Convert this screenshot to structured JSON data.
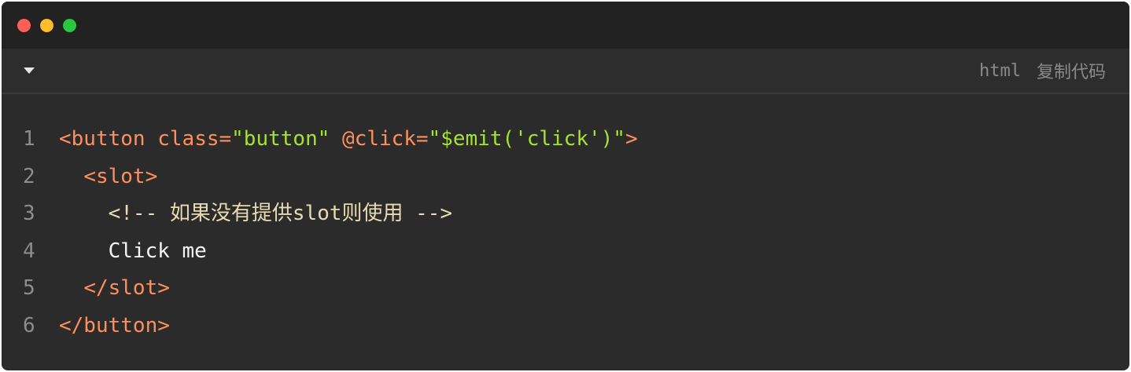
{
  "window": {
    "traffic_lights": [
      {
        "name": "close",
        "color": "#ff5f57"
      },
      {
        "name": "minimize",
        "color": "#febc2e"
      },
      {
        "name": "zoom",
        "color": "#28c840"
      }
    ]
  },
  "toolbar": {
    "collapse_icon": "caret-down-icon",
    "language": "html",
    "copy_label": "复制代码"
  },
  "code": {
    "lines": [
      {
        "number": "1",
        "tokens": [
          {
            "type": "tag",
            "text": "<button "
          },
          {
            "type": "attr",
            "text": "class="
          },
          {
            "type": "str",
            "text": "\"button\" "
          },
          {
            "type": "attr",
            "text": "@click="
          },
          {
            "type": "str",
            "text": "\"$emit('click')\""
          },
          {
            "type": "tag",
            "text": ">"
          }
        ]
      },
      {
        "number": "2",
        "tokens": [
          {
            "type": "text",
            "text": "  "
          },
          {
            "type": "tag",
            "text": "<slot>"
          }
        ]
      },
      {
        "number": "3",
        "tokens": [
          {
            "type": "text",
            "text": "    "
          },
          {
            "type": "comment",
            "text": "<!-- 如果没有提供slot则使用 -->"
          }
        ]
      },
      {
        "number": "4",
        "tokens": [
          {
            "type": "text",
            "text": "    Click me"
          }
        ]
      },
      {
        "number": "5",
        "tokens": [
          {
            "type": "text",
            "text": "  "
          },
          {
            "type": "tag",
            "text": "</slot>"
          }
        ]
      },
      {
        "number": "6",
        "tokens": [
          {
            "type": "tag",
            "text": "</button>"
          }
        ]
      }
    ]
  }
}
